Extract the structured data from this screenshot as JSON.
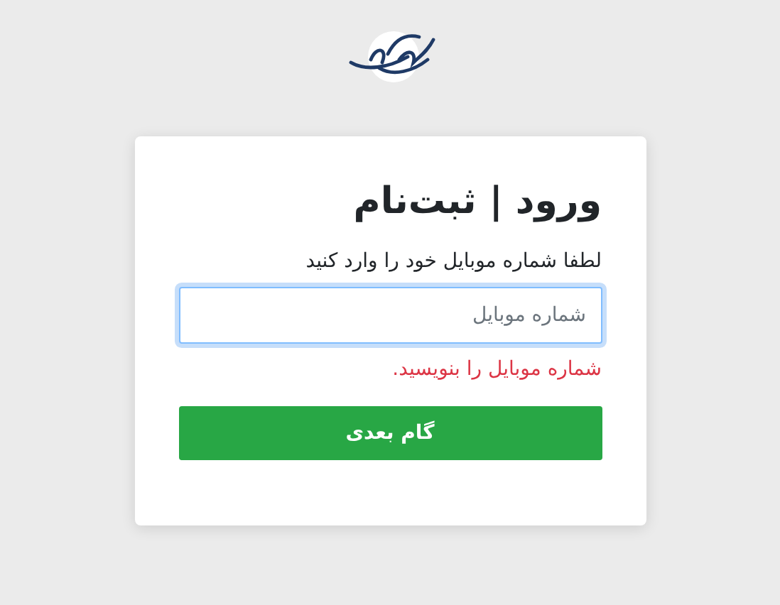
{
  "title": "ورود | ثبت‌نام",
  "instruction": "لطفا شماره موبایل خود را وارد کنید",
  "phone_field": {
    "placeholder": "شماره موبایل",
    "focused": true
  },
  "error": "شماره موبایل را بنویسید.",
  "next_button": "گام بعدی"
}
